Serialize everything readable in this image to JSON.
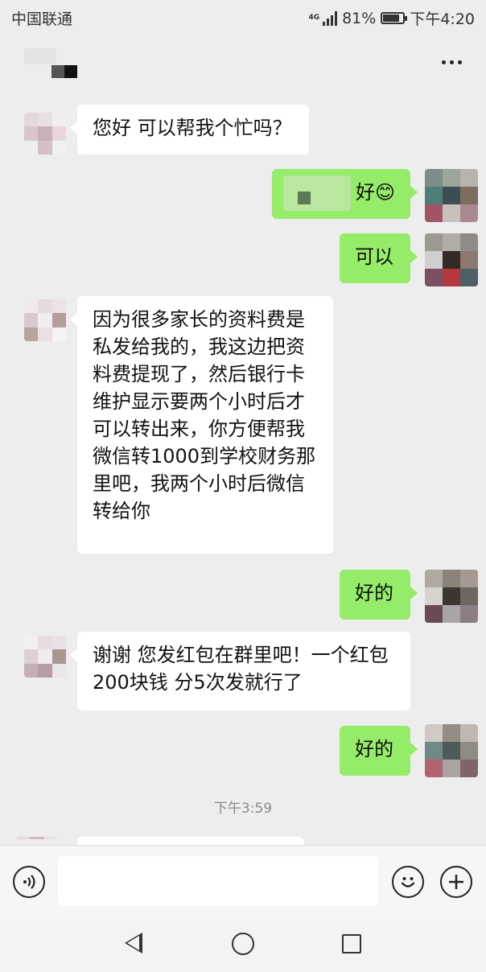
{
  "status_bar": {
    "carrier": "中国联通",
    "network": "4G",
    "battery_percent": "81%",
    "battery_level": 0.81,
    "time": "下午4:20"
  },
  "header": {
    "more_icon": "more-dots-icon"
  },
  "messages": [
    {
      "side": "in",
      "text": "您好 可以帮我个忙吗？"
    },
    {
      "side": "out",
      "text": "好😊"
    },
    {
      "side": "out",
      "text": "可以"
    },
    {
      "side": "in",
      "text": "因为很多家长的资料费是私发给我的，我这边把资料费提现了，然后银行卡维护显示要两个小时后才可以转出来，你方便帮我微信转1000到学校财务那里吧，我两个小时后微信转给你"
    },
    {
      "side": "out",
      "text": "好的"
    },
    {
      "side": "in",
      "text": "谢谢 您发红包在群里吧！一个红包200块钱 分5次发就行了"
    },
    {
      "side": "out",
      "text": "好的"
    }
  ],
  "timestamp": "下午3:59",
  "input_bar": {
    "voice_icon": "voice-icon",
    "emoji_icon": "emoji-icon",
    "plus_icon": "plus-icon"
  },
  "colors": {
    "outgoing_bubble": "#95ec69",
    "incoming_bubble": "#ffffff",
    "background": "#ededed"
  }
}
